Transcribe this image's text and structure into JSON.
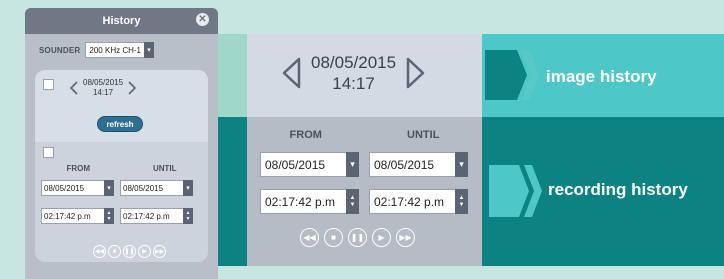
{
  "panel": {
    "title": "History",
    "close_symbol": "✕",
    "sounder_label": "SOUNDER",
    "sounder_value": "200 KHz CH-1",
    "date": "08/05/2015",
    "time": "14:17",
    "refresh_label": "refresh",
    "from_label": "FROM",
    "until_label": "UNTIL",
    "from_date": "08/05/2015",
    "until_date": "08/05/2015",
    "from_time": "02:17:42 p.m",
    "until_time": "02:17:42 p.m"
  },
  "big": {
    "date": "08/05/2015",
    "time": "14:17",
    "from_label": "FROM",
    "until_label": "UNTIL",
    "from_date": "08/05/2015",
    "until_date": "08/05/2015",
    "from_time": "02:17:42 p.m",
    "until_time": "02:17:42 p.m"
  },
  "labels": {
    "image_history": "image history",
    "recording_history": "recording history"
  },
  "colors": {
    "teal_dark": "#0c8282",
    "teal_light": "#4dc7c7",
    "mint": "#9fd7c8",
    "refresh_blue": "#2d6f92"
  },
  "icons": {
    "controls": [
      "rewind-icon",
      "stop-icon",
      "pause-icon",
      "play-icon",
      "fast-forward-icon"
    ]
  }
}
